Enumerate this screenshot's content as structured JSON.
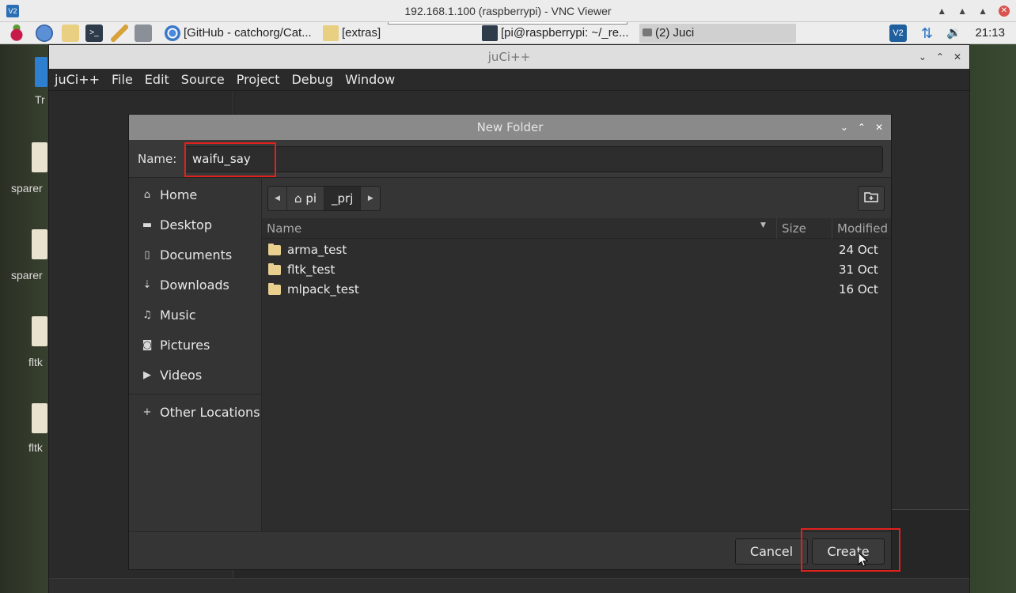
{
  "vnc": {
    "title": "192.168.1.100 (raspberrypi) - VNC Viewer",
    "logo": "V2"
  },
  "taskbar": {
    "tasks": [
      {
        "label": "[GitHub - catchorg/Cat..."
      },
      {
        "label": "[extras]"
      },
      {
        "label": "[pi@raspberrypi: ~/_re..."
      },
      {
        "label": "(2) Juci"
      }
    ],
    "clock": "21:13",
    "vnc_tray": "V2"
  },
  "desktop": {
    "labels": [
      "Tr",
      "sparer",
      "sparer",
      "fltk",
      "fltk"
    ]
  },
  "juci": {
    "title": "juCi++",
    "menu": [
      "juCi++",
      "File",
      "Edit",
      "Source",
      "Project",
      "Debug",
      "Window"
    ]
  },
  "dialog": {
    "title": "New Folder",
    "name_label": "Name:",
    "name_value": "waifu_say",
    "places": [
      {
        "label": "Home",
        "icon": "home-icon"
      },
      {
        "label": "Desktop",
        "icon": "desktop-folder-icon"
      },
      {
        "label": "Documents",
        "icon": "document-icon"
      },
      {
        "label": "Downloads",
        "icon": "download-icon"
      },
      {
        "label": "Music",
        "icon": "music-icon"
      },
      {
        "label": "Pictures",
        "icon": "camera-icon"
      },
      {
        "label": "Videos",
        "icon": "video-icon"
      },
      {
        "label": "Other Locations",
        "icon": "plus-icon"
      }
    ],
    "breadcrumbs": [
      "pi",
      "_prj"
    ],
    "columns": {
      "name": "Name",
      "size": "Size",
      "modified": "Modified"
    },
    "files": [
      {
        "name": "arma_test",
        "size": "",
        "modified": "24 Oct"
      },
      {
        "name": "fltk_test",
        "size": "",
        "modified": "31 Oct"
      },
      {
        "name": "mlpack_test",
        "size": "",
        "modified": "16 Oct"
      }
    ],
    "cancel_label": "Cancel",
    "create_label": "Create"
  },
  "colors": {
    "highlight": "#e0211d",
    "folder": "#e9d08f",
    "dialog_title_bar": "#8a8a8a"
  }
}
